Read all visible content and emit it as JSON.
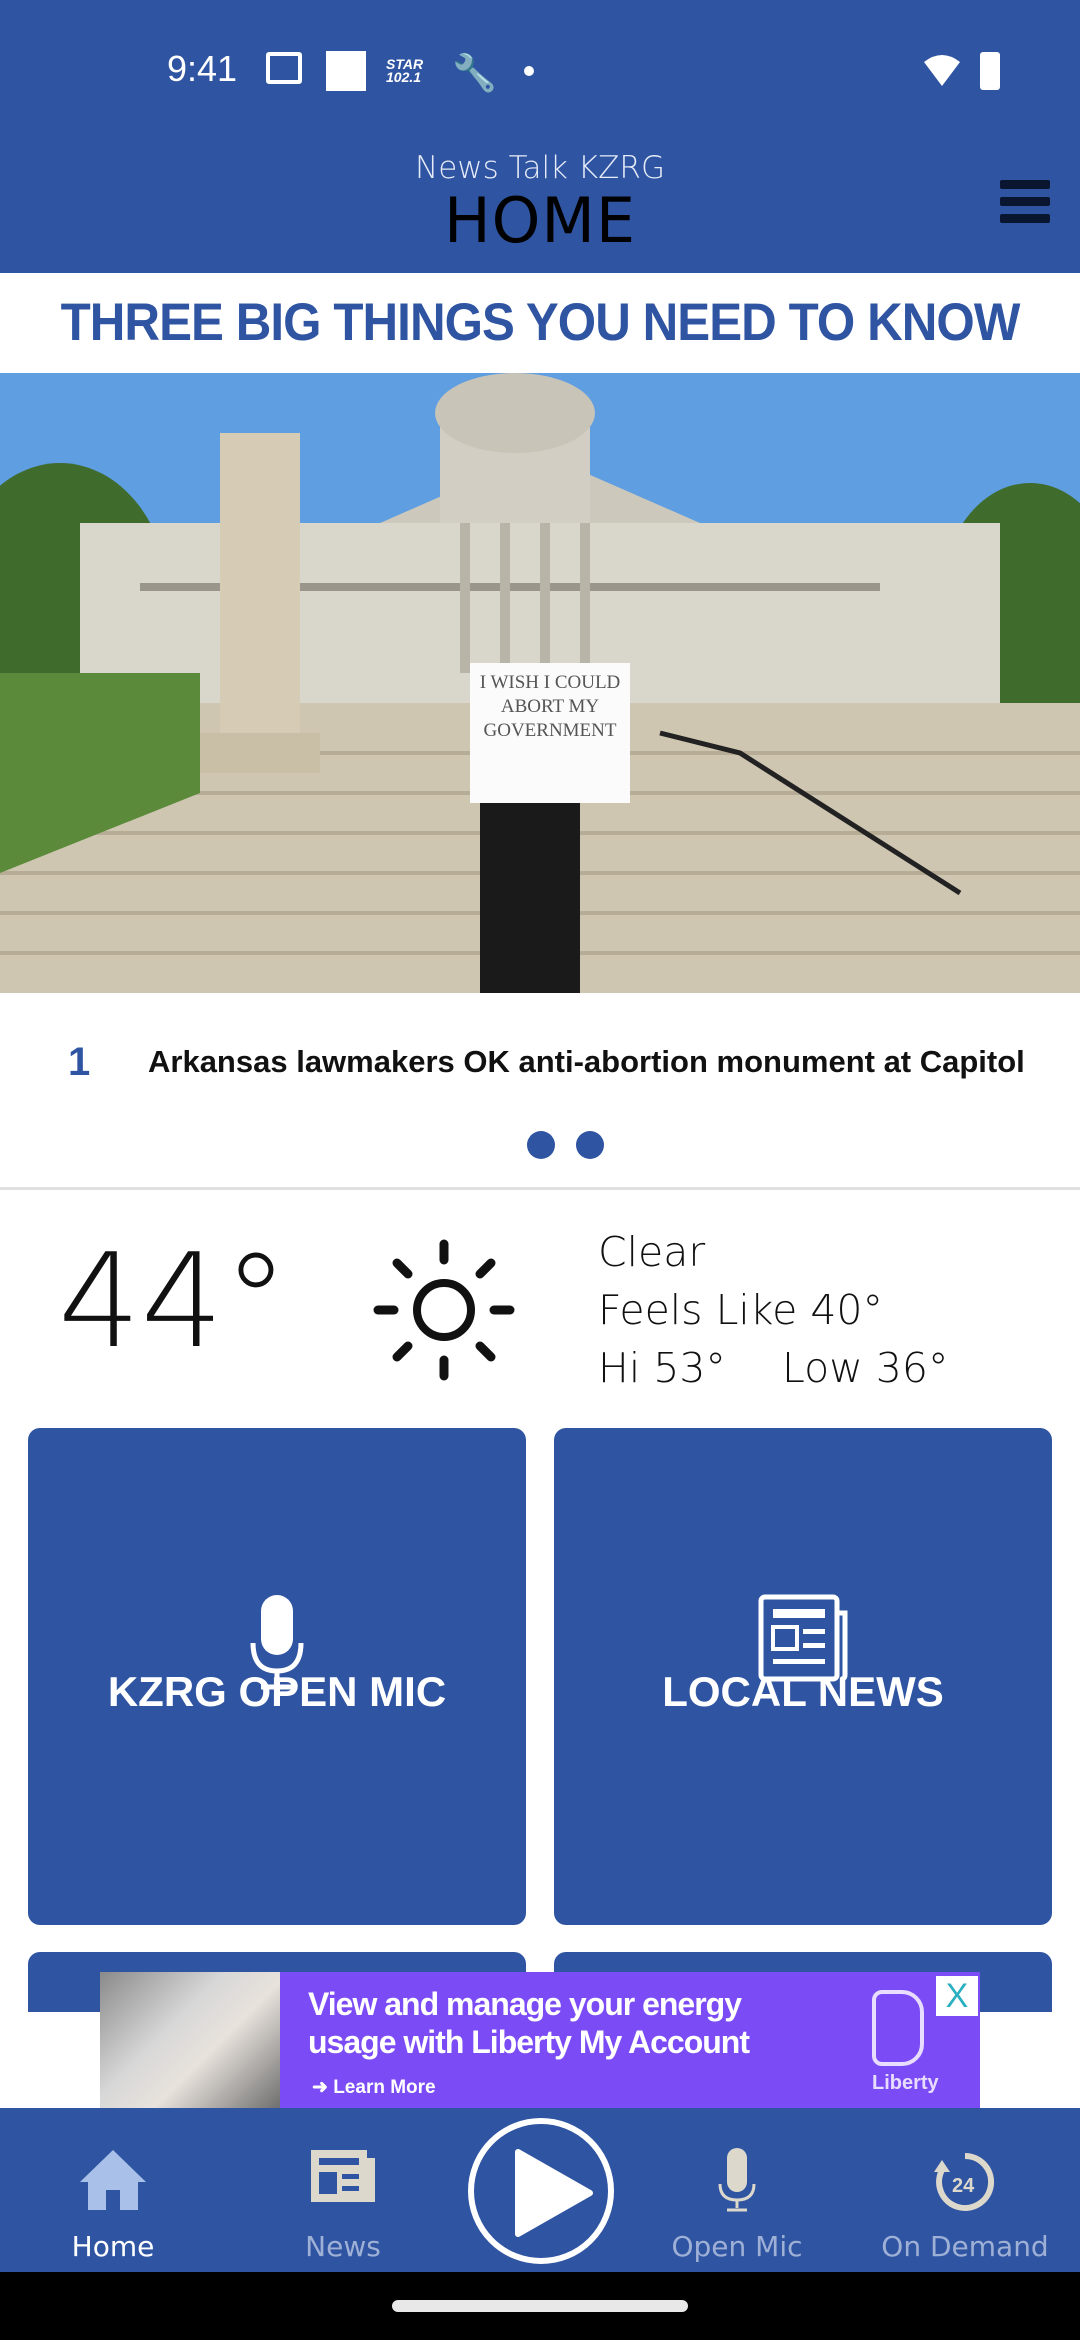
{
  "status_bar": {
    "time": "9:41",
    "icons": [
      "gmail-icon",
      "square-icon",
      "star-102-icon",
      "wrench-icon",
      "dot-icon",
      "wifi-icon",
      "battery-icon"
    ],
    "star_label": "STAR 102.1"
  },
  "header": {
    "subtitle": "News Talk KZRG",
    "title": "HOME"
  },
  "section": {
    "title": "THREE BIG THINGS YOU NEED TO KNOW"
  },
  "carousel": {
    "items": [
      {
        "number": "1",
        "headline": "Arkansas lawmakers OK anti-abortion monument at Capitol",
        "image_sign_text": "I WISH I COULD ABORT MY GOVERNMENT"
      }
    ],
    "page_count": 2
  },
  "weather": {
    "temperature": "44°",
    "condition": "Clear",
    "feels_like": "Feels Like 40°",
    "hi": "Hi 53°",
    "low": "Low 36°",
    "icon": "sun-icon"
  },
  "tiles": [
    {
      "label": "KZRG OPEN MIC",
      "icon": "microphone-icon"
    },
    {
      "label": "LOCAL NEWS",
      "icon": "newspaper-icon"
    }
  ],
  "ad": {
    "line1": "View and manage your energy",
    "line2": "usage with Liberty My Account",
    "cta": "Learn More",
    "brand": "Liberty",
    "close": "X"
  },
  "bottom_nav": {
    "items": [
      {
        "label": "Home",
        "active": true
      },
      {
        "label": "News"
      },
      {
        "label": "Open Mic"
      },
      {
        "label": "On Demand"
      }
    ],
    "on_demand_badge": "24"
  },
  "colors": {
    "brand_blue": "#2f54a2",
    "ad_purple": "#7b4cf5"
  }
}
